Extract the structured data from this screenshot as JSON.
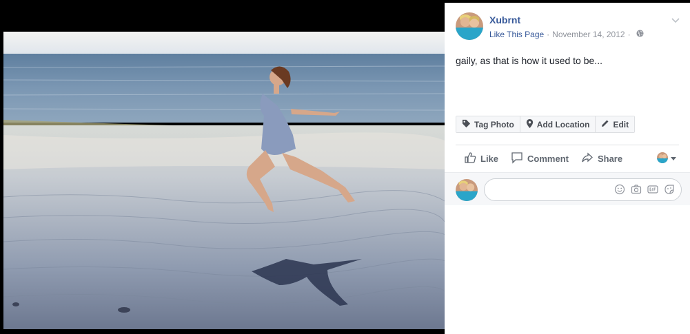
{
  "post": {
    "page_name": "Xubrnt",
    "like_page": "Like This Page",
    "separator": "·",
    "date": "November 14, 2012",
    "privacy_icon": "globe-icon",
    "caption": "gaily, as that is how it used to be..."
  },
  "photo_actions": {
    "tag_photo": "Tag Photo",
    "add_location": "Add Location",
    "edit": "Edit"
  },
  "reactions": {
    "like": "Like",
    "comment": "Comment",
    "share": "Share"
  },
  "comment": {
    "placeholder": "",
    "icons": [
      "emoji-icon",
      "camera-icon",
      "gif-icon",
      "sticker-icon"
    ]
  },
  "photo": {
    "subject": "woman leaping on beach",
    "colors": {
      "sky": "#dfe6ee",
      "sea": "#6f8fb0",
      "sand": "#b9c3cf"
    }
  },
  "colors": {
    "link": "#365899",
    "meta": "#90949c",
    "text": "#1d2129"
  }
}
